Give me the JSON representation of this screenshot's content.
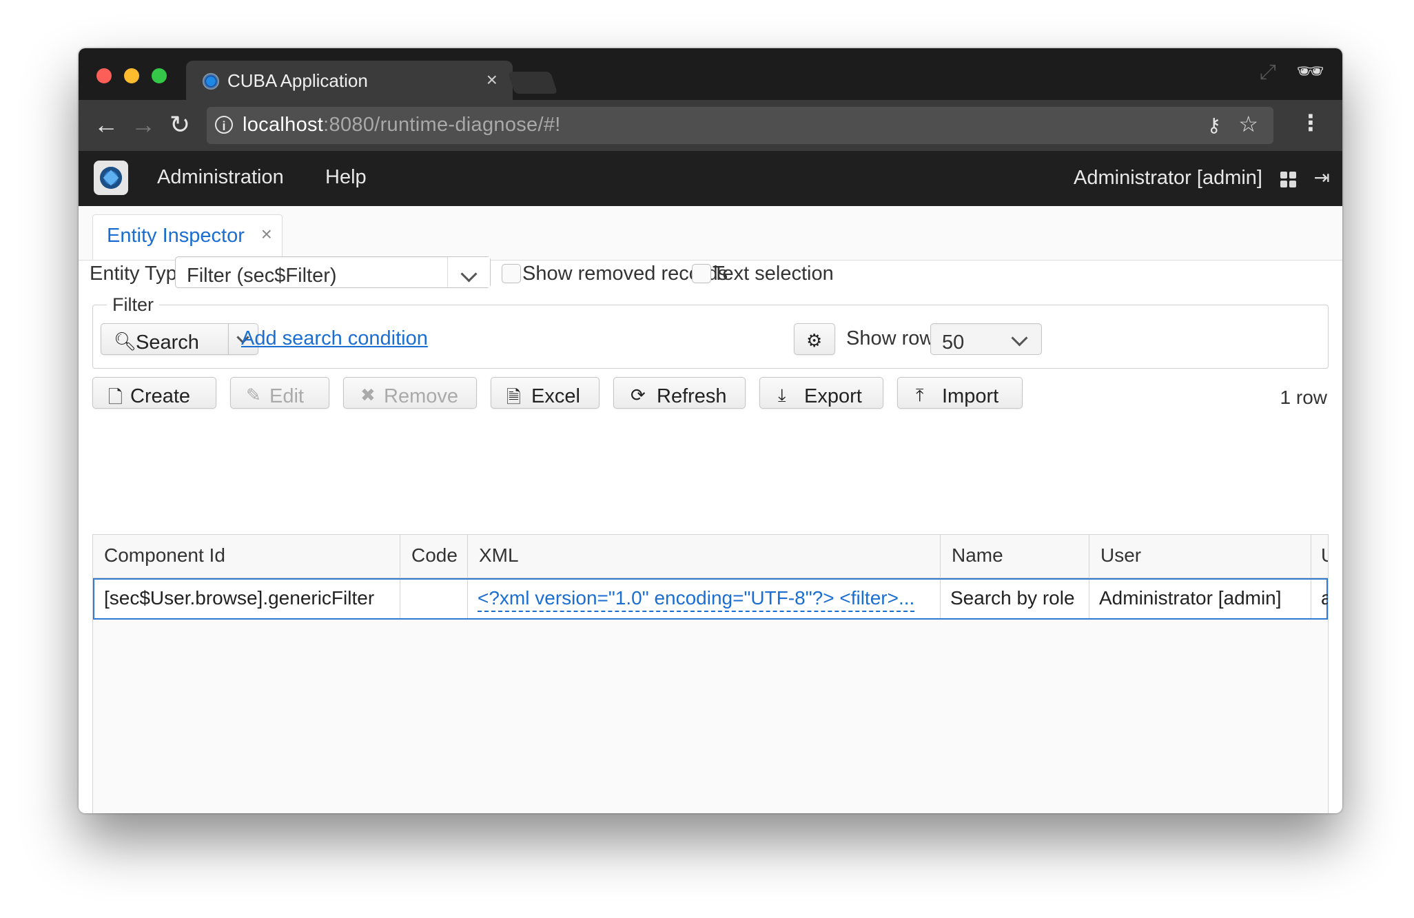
{
  "browser": {
    "tab_title": "CUBA Application",
    "tab_close": "×",
    "url_host": "localhost",
    "url_rest": ":8080/runtime-diagnose/#!"
  },
  "app": {
    "menu": [
      "Administration",
      "Help"
    ],
    "user": "Administrator [admin]"
  },
  "screen_tab": {
    "label": "Entity Inspector",
    "close": "×"
  },
  "entity_type": {
    "label": "Entity Type",
    "value": "Filter (sec$Filter)",
    "show_removed_label": "Show removed records",
    "text_selection_label": "Text selection"
  },
  "filter": {
    "legend": "Filter",
    "search_label": "Search",
    "add_condition_label": "Add search condition",
    "show_rows_label": "Show rows",
    "show_rows_value": "50"
  },
  "actions": {
    "create": "Create",
    "edit": "Edit",
    "remove": "Remove",
    "excel": "Excel",
    "refresh": "Refresh",
    "export": "Export",
    "import": "Import",
    "row_count": "1 row"
  },
  "table": {
    "columns": [
      "Component Id",
      "Code",
      "XML",
      "Name",
      "User",
      "U"
    ],
    "rows": [
      [
        "[sec$User.browse].genericFilter",
        "",
        "<?xml version=\"1.0\" encoding=\"UTF-8\"?> <filter>...",
        "Search by role",
        "Administrator [admin]",
        "a"
      ]
    ]
  },
  "colors": {
    "accent": "#1b6ed1",
    "header_bg": "#1f1f1f",
    "selection_border": "#2f7bd1"
  }
}
